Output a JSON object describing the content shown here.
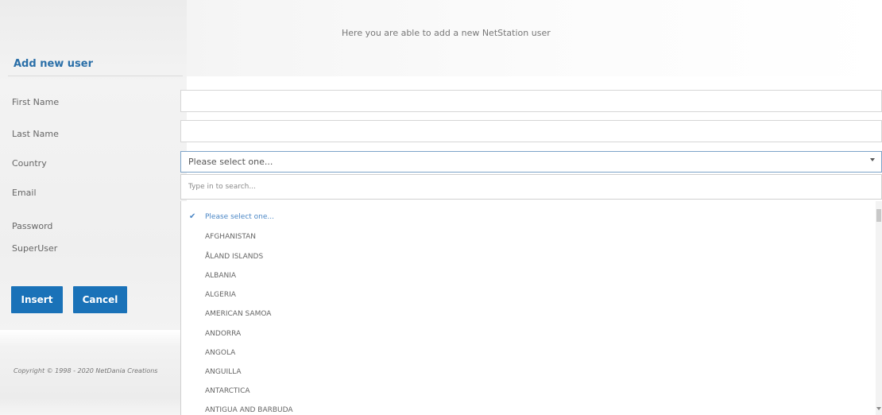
{
  "intro": "Here you are able to add a new NetStation user",
  "section_title": "Add new user",
  "form": {
    "labels": {
      "first_name": "First Name",
      "last_name": "Last Name",
      "country": "Country",
      "email": "Email",
      "password": "Password",
      "superuser": "SuperUser"
    },
    "first_name_value": "",
    "last_name_value": "",
    "country_selected": "Please select one...",
    "country_search_placeholder": "Type in to search...",
    "country_options": [
      "Please select one...",
      "AFGHANISTAN",
      "ÅLAND ISLANDS",
      "ALBANIA",
      "ALGERIA",
      "AMERICAN SAMOA",
      "ANDORRA",
      "ANGOLA",
      "ANGUILLA",
      "ANTARCTICA",
      "ANTIGUA AND BARBUDA"
    ]
  },
  "buttons": {
    "insert": "Insert",
    "cancel": "Cancel"
  },
  "footer": "Copyright © 1998 - 2020 NetDania Creations",
  "colors": {
    "accent": "#1a72b8",
    "title": "#2a6fa8",
    "selected_option": "#4a86c5"
  }
}
